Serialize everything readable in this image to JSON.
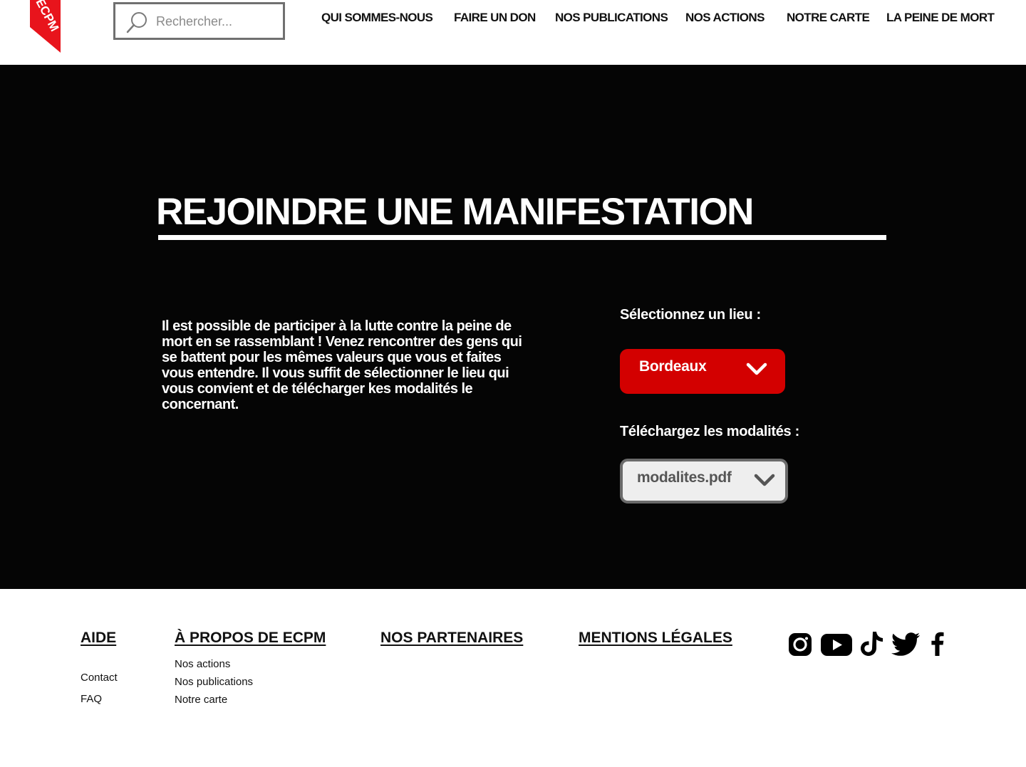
{
  "header": {
    "logo_text": "ECPM",
    "search": {
      "placeholder": "Rechercher..."
    },
    "nav": [
      {
        "label": "QUI SOMMES-NOUS"
      },
      {
        "label": "FAIRE UN DON"
      },
      {
        "label": "NOS PUBLICATIONS"
      },
      {
        "label": "NOS ACTIONS"
      },
      {
        "label": "NOTRE CARTE"
      },
      {
        "label": "LA PEINE DE MORT"
      }
    ]
  },
  "hero": {
    "title": "REJOINDRE UNE MANIFESTATION",
    "text": "Il est possible de participer à la lutte contre la peine de mort en se rassemblant ! Venez rencontrer des gens qui se battent pour les mêmes valeurs que vous et faites vous entendre. Il vous suffit de sélectionner le lieu qui vous convient et de télécharger kes modalités le concernant.",
    "lieu_label": "Sélectionnez un lieu :",
    "lieu_value": "Bordeaux",
    "modal_label": "Téléchargez les modalités :",
    "modal_value": "modalites.pdf"
  },
  "footer": {
    "aide": {
      "heading": "AIDE",
      "links": [
        "Contact",
        "FAQ"
      ]
    },
    "apropos": {
      "heading": "À PROPOS DE ECPM",
      "links": [
        "Nos actions",
        "Nos publications",
        "Notre carte"
      ]
    },
    "partenaires": {
      "heading": "NOS PARTENAIRES"
    },
    "mentions": {
      "heading": "MENTIONS LÉGALES"
    },
    "social_icons": [
      "instagram-icon",
      "youtube-icon",
      "tiktok-icon",
      "twitter-icon",
      "facebook-icon"
    ]
  },
  "colors": {
    "brand_red": "#d30000",
    "hero_bg": "#050505",
    "select_grey": "#eeeeee"
  }
}
